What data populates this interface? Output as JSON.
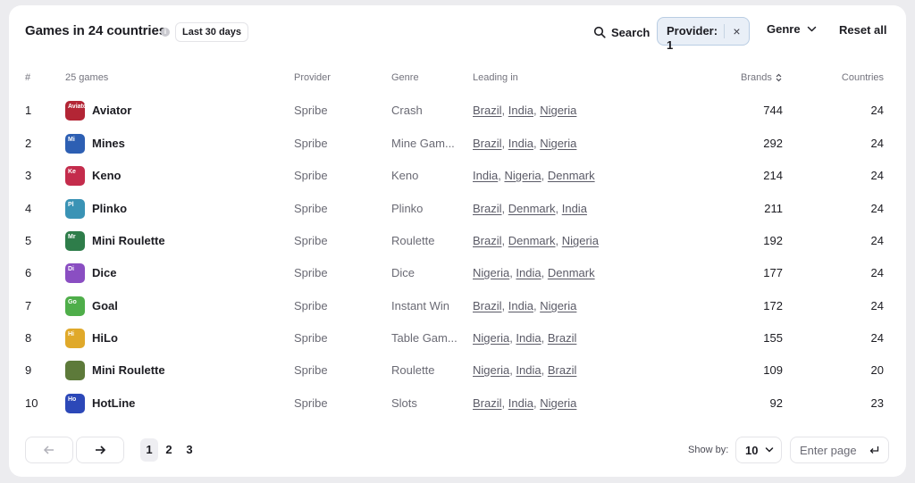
{
  "header": {
    "title": "Games in 24 countries",
    "info_icon": "info-icon",
    "period": "Last 30 days",
    "search_label": "Search",
    "filter_chip_label": "Provider: 1",
    "filter_chip_close": "×",
    "genre_label": "Genre",
    "reset_label": "Reset all"
  },
  "table": {
    "columns": {
      "num": "#",
      "games": "25 games",
      "provider": "Provider",
      "genre": "Genre",
      "leading": "Leading in",
      "brands": "Brands",
      "countries": "Countries"
    },
    "rows": [
      {
        "num": "1",
        "icon_text": "Aviator",
        "icon_color": "#b32535",
        "name": "Aviator",
        "provider": "Spribe",
        "genre": "Crash",
        "leading": [
          "Brazil",
          "India",
          "Nigeria"
        ],
        "brands": "744",
        "countries": "24"
      },
      {
        "num": "2",
        "icon_text": "Mi",
        "icon_color": "#2d5fb3",
        "name": "Mines",
        "provider": "Spribe",
        "genre": "Mine Gam...",
        "leading": [
          "Brazil",
          "India",
          "Nigeria"
        ],
        "brands": "292",
        "countries": "24"
      },
      {
        "num": "3",
        "icon_text": "Ke",
        "icon_color": "#c42c4c",
        "name": "Keno",
        "provider": "Spribe",
        "genre": "Keno",
        "leading": [
          "India",
          "Nigeria",
          "Denmark"
        ],
        "brands": "214",
        "countries": "24"
      },
      {
        "num": "4",
        "icon_text": "Pl",
        "icon_color": "#3a93b5",
        "name": "Plinko",
        "provider": "Spribe",
        "genre": "Plinko",
        "leading": [
          "Brazil",
          "Denmark",
          "India"
        ],
        "brands": "211",
        "countries": "24"
      },
      {
        "num": "5",
        "icon_text": "Mr",
        "icon_color": "#2e7d4a",
        "name": "Mini Roulette",
        "provider": "Spribe",
        "genre": "Roulette",
        "leading": [
          "Brazil",
          "Denmark",
          "Nigeria"
        ],
        "brands": "192",
        "countries": "24"
      },
      {
        "num": "6",
        "icon_text": "Di",
        "icon_color": "#8a4ec2",
        "name": "Dice",
        "provider": "Spribe",
        "genre": "Dice",
        "leading": [
          "Nigeria",
          "India",
          "Denmark"
        ],
        "brands": "177",
        "countries": "24"
      },
      {
        "num": "7",
        "icon_text": "Go",
        "icon_color": "#4fae4a",
        "name": "Goal",
        "provider": "Spribe",
        "genre": "Instant Win",
        "leading": [
          "Brazil",
          "India",
          "Nigeria"
        ],
        "brands": "172",
        "countries": "24"
      },
      {
        "num": "8",
        "icon_text": "Hi",
        "icon_color": "#e0a92a",
        "name": "HiLo",
        "provider": "Spribe",
        "genre": "Table Gam...",
        "leading": [
          "Nigeria",
          "India",
          "Brazil"
        ],
        "brands": "155",
        "countries": "24"
      },
      {
        "num": "9",
        "icon_text": "",
        "icon_color": "#5d7a3a",
        "name": "Mini Roulette",
        "provider": "Spribe",
        "genre": "Roulette",
        "leading": [
          "Nigeria",
          "India",
          "Brazil"
        ],
        "brands": "109",
        "countries": "20"
      },
      {
        "num": "10",
        "icon_text": "Ho",
        "icon_color": "#2c48b8",
        "name": "HotLine",
        "provider": "Spribe",
        "genre": "Slots",
        "leading": [
          "Brazil",
          "India",
          "Nigeria"
        ],
        "brands": "92",
        "countries": "23"
      }
    ]
  },
  "footer": {
    "prev_icon": "arrow-left-icon",
    "next_icon": "arrow-right-icon",
    "pages": [
      "1",
      "2",
      "3"
    ],
    "active_page": "1",
    "show_by_label": "Show by:",
    "show_by_value": "10",
    "enter_page_placeholder": "Enter page",
    "enter_icon": "enter-return-icon"
  }
}
